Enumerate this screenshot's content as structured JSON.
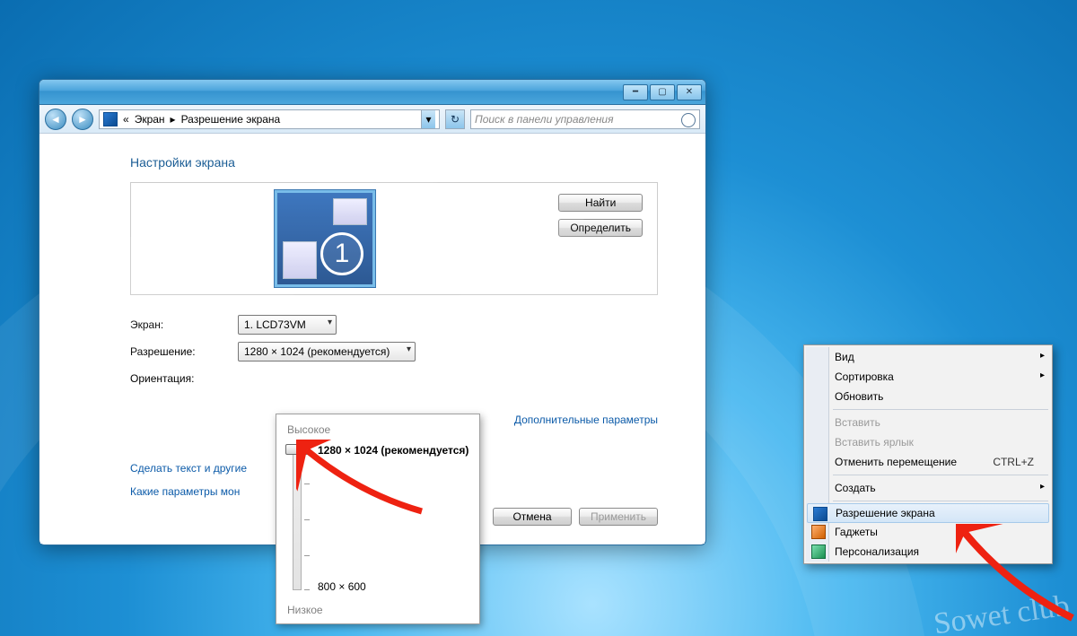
{
  "breadcrumb": {
    "segment1": "Экран",
    "segment2": "Разрешение экрана",
    "back_prefix": "«"
  },
  "search": {
    "placeholder": "Поиск в панели управления"
  },
  "heading": "Настройки экрана",
  "monitor": {
    "number": "1"
  },
  "buttons": {
    "find": "Найти",
    "identify": "Определить",
    "cancel": "Отмена",
    "apply": "Применить"
  },
  "labels": {
    "screen": "Экран:",
    "resolution": "Разрешение:",
    "orientation": "Ориентация:"
  },
  "combos": {
    "screen_value": "1. LCD73VM",
    "resolution_value": "1280 × 1024 (рекомендуется)"
  },
  "links": {
    "advanced": "Дополнительные параметры",
    "text_size": "Сделать текст и другие",
    "which_monitor": "Какие параметры мон"
  },
  "slider": {
    "high": "Высокое",
    "low": "Низкое",
    "top_label": "1280 × 1024 (рекомендуется)",
    "bottom_label": "800 × 600"
  },
  "context_menu": {
    "view": "Вид",
    "sort": "Сортировка",
    "refresh": "Обновить",
    "paste": "Вставить",
    "paste_link": "Вставить ярлык",
    "undo_move": "Отменить перемещение",
    "undo_shortcut": "CTRL+Z",
    "create": "Создать",
    "resolution": "Разрешение экрана",
    "gadgets": "Гаджеты",
    "personalize": "Персонализация"
  },
  "watermark": "Sowet club"
}
